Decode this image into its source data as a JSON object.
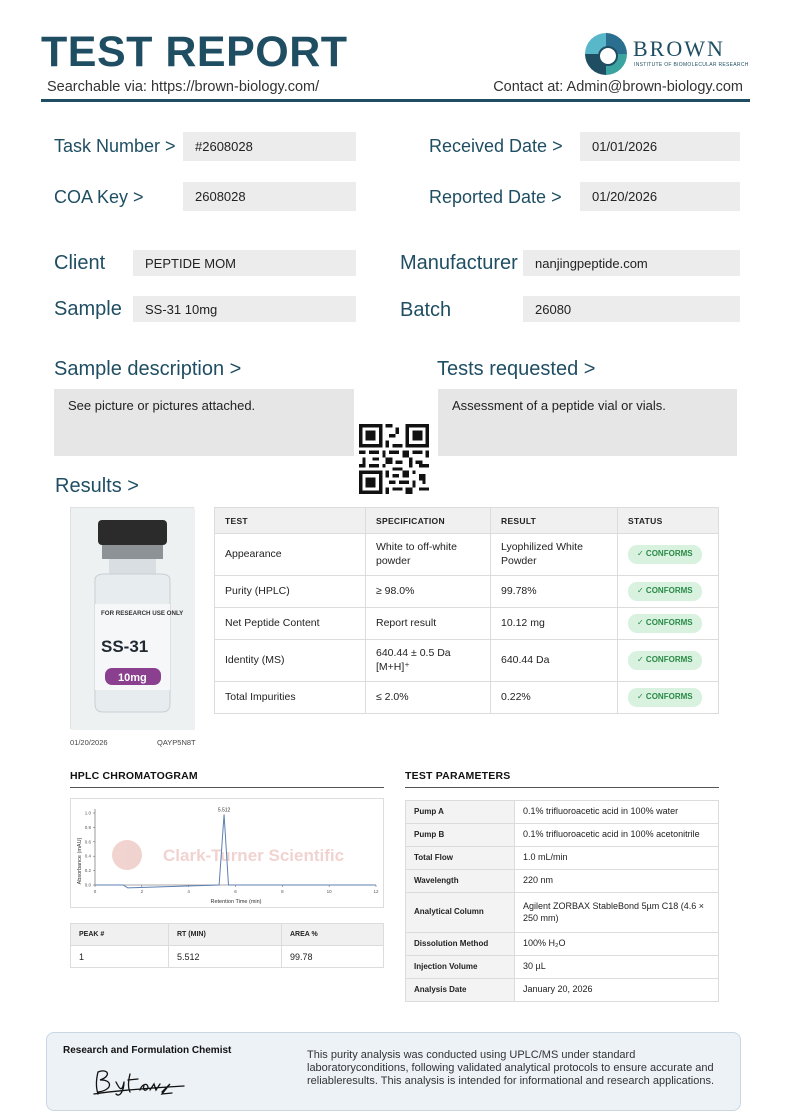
{
  "header": {
    "title": "TEST REPORT",
    "search": "Searchable via: https://brown-biology.com/",
    "contact": "Contact at: Admin@brown-biology.com",
    "logo_name": "BROWN",
    "logo_sub": "INSTITUTE OF BIOMOLECULAR RESEARCH"
  },
  "info": {
    "task_label": "Task Number  >",
    "task_value": "#2608028",
    "received_label": "Received Date  >",
    "received_value": "01/01/2026",
    "coa_label": "COA  Key >",
    "coa_value": "2608028",
    "reported_label": "Reported Date >",
    "reported_value": "01/20/2026",
    "client_label": "Client",
    "client_value": "PEPTIDE MOM",
    "manufacturer_label": "Manufacturer",
    "manufacturer_value": "nanjingpeptide.com",
    "sample_label": "Sample",
    "sample_value": "SS-31 10mg",
    "batch_label": "Batch",
    "batch_value": "26080"
  },
  "description": {
    "sample_heading": "Sample description   >",
    "sample_text": "See picture or pictures attached.",
    "tests_heading": "Tests requested   >",
    "tests_text": "Assessment of a peptide vial or vials."
  },
  "results": {
    "heading": "Results  >",
    "columns": [
      "TEST",
      "SPECIFICATION",
      "RESULT",
      "STATUS"
    ],
    "rows": [
      {
        "test": "Appearance",
        "spec": "White to off-white powder",
        "result": "Lyophilized White Powder",
        "status": "✓ CONFORMS"
      },
      {
        "test": "Purity (HPLC)",
        "spec": "≥ 98.0%",
        "result": "99.78%",
        "status": "✓ CONFORMS"
      },
      {
        "test": "Net Peptide Content",
        "spec": "Report result",
        "result": "10.12 mg",
        "status": "✓ CONFORMS"
      },
      {
        "test": "Identity (MS)",
        "spec": "640.44 ± 0.5 Da [M+H]⁺",
        "result": "640.44 Da",
        "status": "✓ CONFORMS"
      },
      {
        "test": "Total Impurities",
        "spec": "≤ 2.0%",
        "result": "0.22%",
        "status": "✓ CONFORMS"
      }
    ]
  },
  "vial": {
    "research_text": "FOR RESEARCH USE ONLY",
    "name": "SS-31",
    "dose": "10mg",
    "date": "01/20/2026",
    "code": "QAYP5N8T"
  },
  "hplc": {
    "heading": "HPLC CHROMATOGRAM",
    "watermark": "Clark-Turner Scientific",
    "peak_label": "5.512",
    "ylabel": "Absorbance (mAU)",
    "xlabel": "Retention Time (min)",
    "peak_columns": [
      "PEAK #",
      "RT (MIN)",
      "AREA %"
    ],
    "peaks": [
      {
        "peak": "1",
        "rt": "5.512",
        "area": "99.78"
      }
    ]
  },
  "chart_data": {
    "type": "line",
    "title": "",
    "xlabel": "Retention Time (min)",
    "ylabel": "Absorbance (mAU)",
    "xlim": [
      0,
      12
    ],
    "ylim": [
      0,
      1.0
    ],
    "x_ticks": [
      "0",
      "2",
      "4",
      "6",
      "8",
      "10",
      "12"
    ],
    "y_ticks": [
      "0.0",
      "0.2",
      "0.4",
      "0.6",
      "0.8",
      "1.0"
    ],
    "series": [
      {
        "x": [
          0,
          1.2,
          1.4,
          5.3,
          5.512,
          5.7,
          12
        ],
        "y": [
          0,
          0,
          -0.04,
          0,
          0.98,
          0,
          0
        ]
      }
    ],
    "annotations": [
      "5.512"
    ]
  },
  "params": {
    "heading": "TEST PARAMETERS",
    "rows": [
      {
        "key": "Pump A",
        "value": "0.1% trifluoroacetic acid in 100% water"
      },
      {
        "key": "Pump B",
        "value": "0.1% trifluoroacetic acid in 100% acetonitrile"
      },
      {
        "key": "Total Flow",
        "value": "1.0 mL/min"
      },
      {
        "key": "Wavelength",
        "value": "220 nm"
      },
      {
        "key": "Analytical Column",
        "value": "Agilent ZORBAX StableBond 5µm C18 (4.6 × 250 mm)"
      },
      {
        "key": "Dissolution Method",
        "value": "100% H₂O"
      },
      {
        "key": "Injection Volume",
        "value": "30 µL"
      },
      {
        "key": "Analysis Date",
        "value": "January 20, 2026"
      }
    ]
  },
  "footer": {
    "chemist_label": "Research and Formulation Chemist",
    "signature": "Byfbanz",
    "text": "This purity analysis was conducted using UPLC/MS under standard laboratoryconditions, following validated analytical protocols to ensure accurate and reliableresults. This analysis is intended for informational and research applications."
  },
  "colors": {
    "brand": "#1f4e63",
    "conforms_bg": "#d9f2df",
    "conforms_text": "#2a8a47",
    "vial_label": "#8b3f8f"
  }
}
